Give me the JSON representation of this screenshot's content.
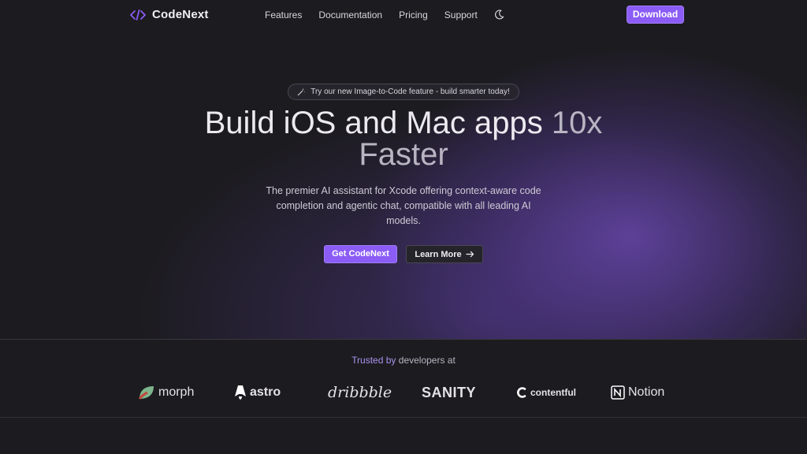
{
  "nav": {
    "brand": "CodeNext",
    "links": [
      "Features",
      "Documentation",
      "Pricing",
      "Support"
    ],
    "download_label": "Download"
  },
  "hero": {
    "badge_text": "Try our new Image-to-Code feature - build smarter today!",
    "headline_part1": "Build iOS and Mac apps",
    "headline_part2": "10x",
    "headline_part3": "Faster",
    "subtext": "The premier AI assistant for Xcode offering context-aware code completion and agentic chat, compatible with all leading AI models.",
    "primary_cta": "Get CodeNext",
    "secondary_cta": "Learn More"
  },
  "trusted": {
    "part1": "Trusted by",
    "part2": "developers at",
    "logos": [
      "morph",
      "astro",
      "dribbble",
      "SANITY",
      "contentful",
      "Notion"
    ]
  },
  "colors": {
    "accent": "#8b5cf6",
    "background": "#1c1b1f",
    "trusted_accent": "#a994ee"
  }
}
